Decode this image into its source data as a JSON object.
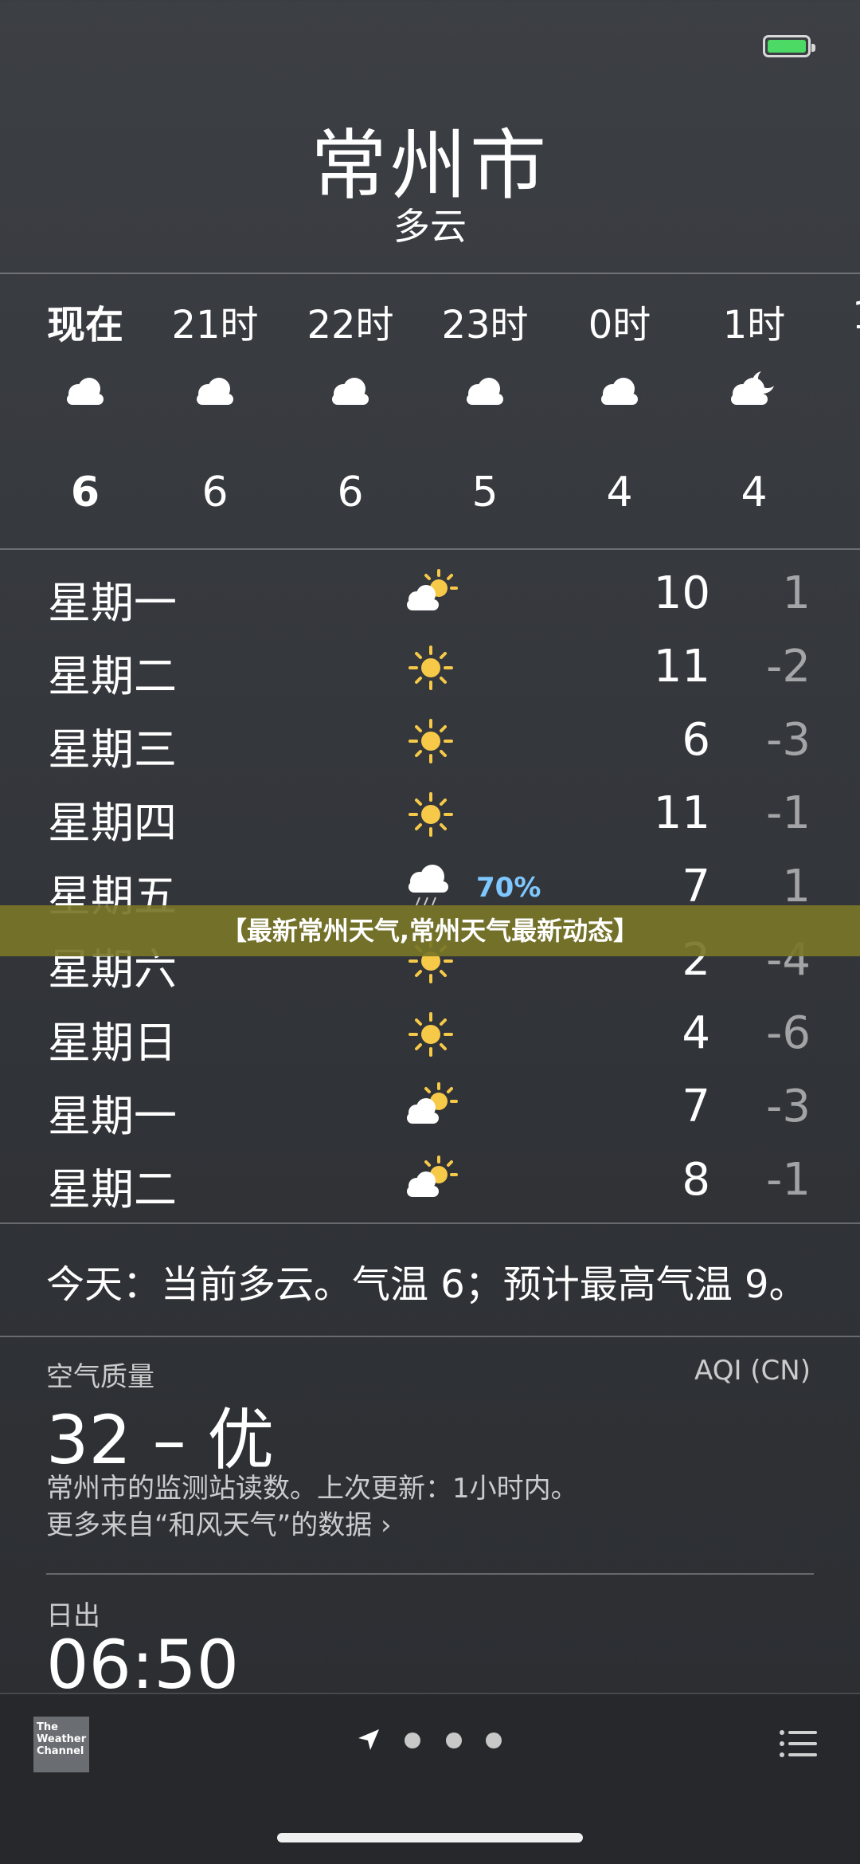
{
  "header": {
    "city": "常州市",
    "condition": "多云"
  },
  "hourly": [
    {
      "label": "现在",
      "icon": "cloud-icon",
      "temp": "6"
    },
    {
      "label": "21时",
      "icon": "cloud-icon",
      "temp": "6"
    },
    {
      "label": "22时",
      "icon": "cloud-icon",
      "temp": "6"
    },
    {
      "label": "23时",
      "icon": "cloud-icon",
      "temp": "5"
    },
    {
      "label": "0时",
      "icon": "cloud-icon",
      "temp": "4"
    },
    {
      "label": "1时",
      "icon": "cloud-moon-icon",
      "temp": "4"
    }
  ],
  "daily": [
    {
      "day": "星期一",
      "icon": "partly-sunny-icon",
      "high": "10",
      "low": "1"
    },
    {
      "day": "星期二",
      "icon": "sun-icon",
      "high": "11",
      "low": "-2"
    },
    {
      "day": "星期三",
      "icon": "sun-icon",
      "high": "6",
      "low": "-3"
    },
    {
      "day": "星期四",
      "icon": "sun-icon",
      "high": "11",
      "low": "-1"
    },
    {
      "day": "星期五",
      "icon": "rain-icon",
      "precip": "70%",
      "high": "7",
      "low": "1"
    },
    {
      "day": "星期六",
      "icon": "sun-icon",
      "high": "2",
      "low": "-4"
    },
    {
      "day": "星期日",
      "icon": "sun-icon",
      "high": "4",
      "low": "-6"
    },
    {
      "day": "星期一",
      "icon": "partly-sunny-icon",
      "high": "7",
      "low": "-3"
    },
    {
      "day": "星期二",
      "icon": "partly-sunny-icon",
      "high": "8",
      "low": "-1"
    }
  ],
  "banner": "【最新常州天气,常州天气最新动态】",
  "summary": "今天：当前多云。气温 6；预计最高气温 9。",
  "aqi": {
    "title": "空气质量",
    "standard": "AQI (CN)",
    "value": "32 – 优",
    "note": "常州市的监测站读数。上次更新：1小时内。",
    "link": "更多来自“和风天气”的数据 ›"
  },
  "sunrise": {
    "title": "日出",
    "time": "06:50"
  },
  "footer": {
    "logo": "The Weather Channel",
    "menu_icon": "list-icon",
    "location_icon": "location-arrow-icon"
  },
  "colors": {
    "battery": "#4cd964",
    "precip": "#7ec7ff",
    "sun": "#f7c948"
  }
}
